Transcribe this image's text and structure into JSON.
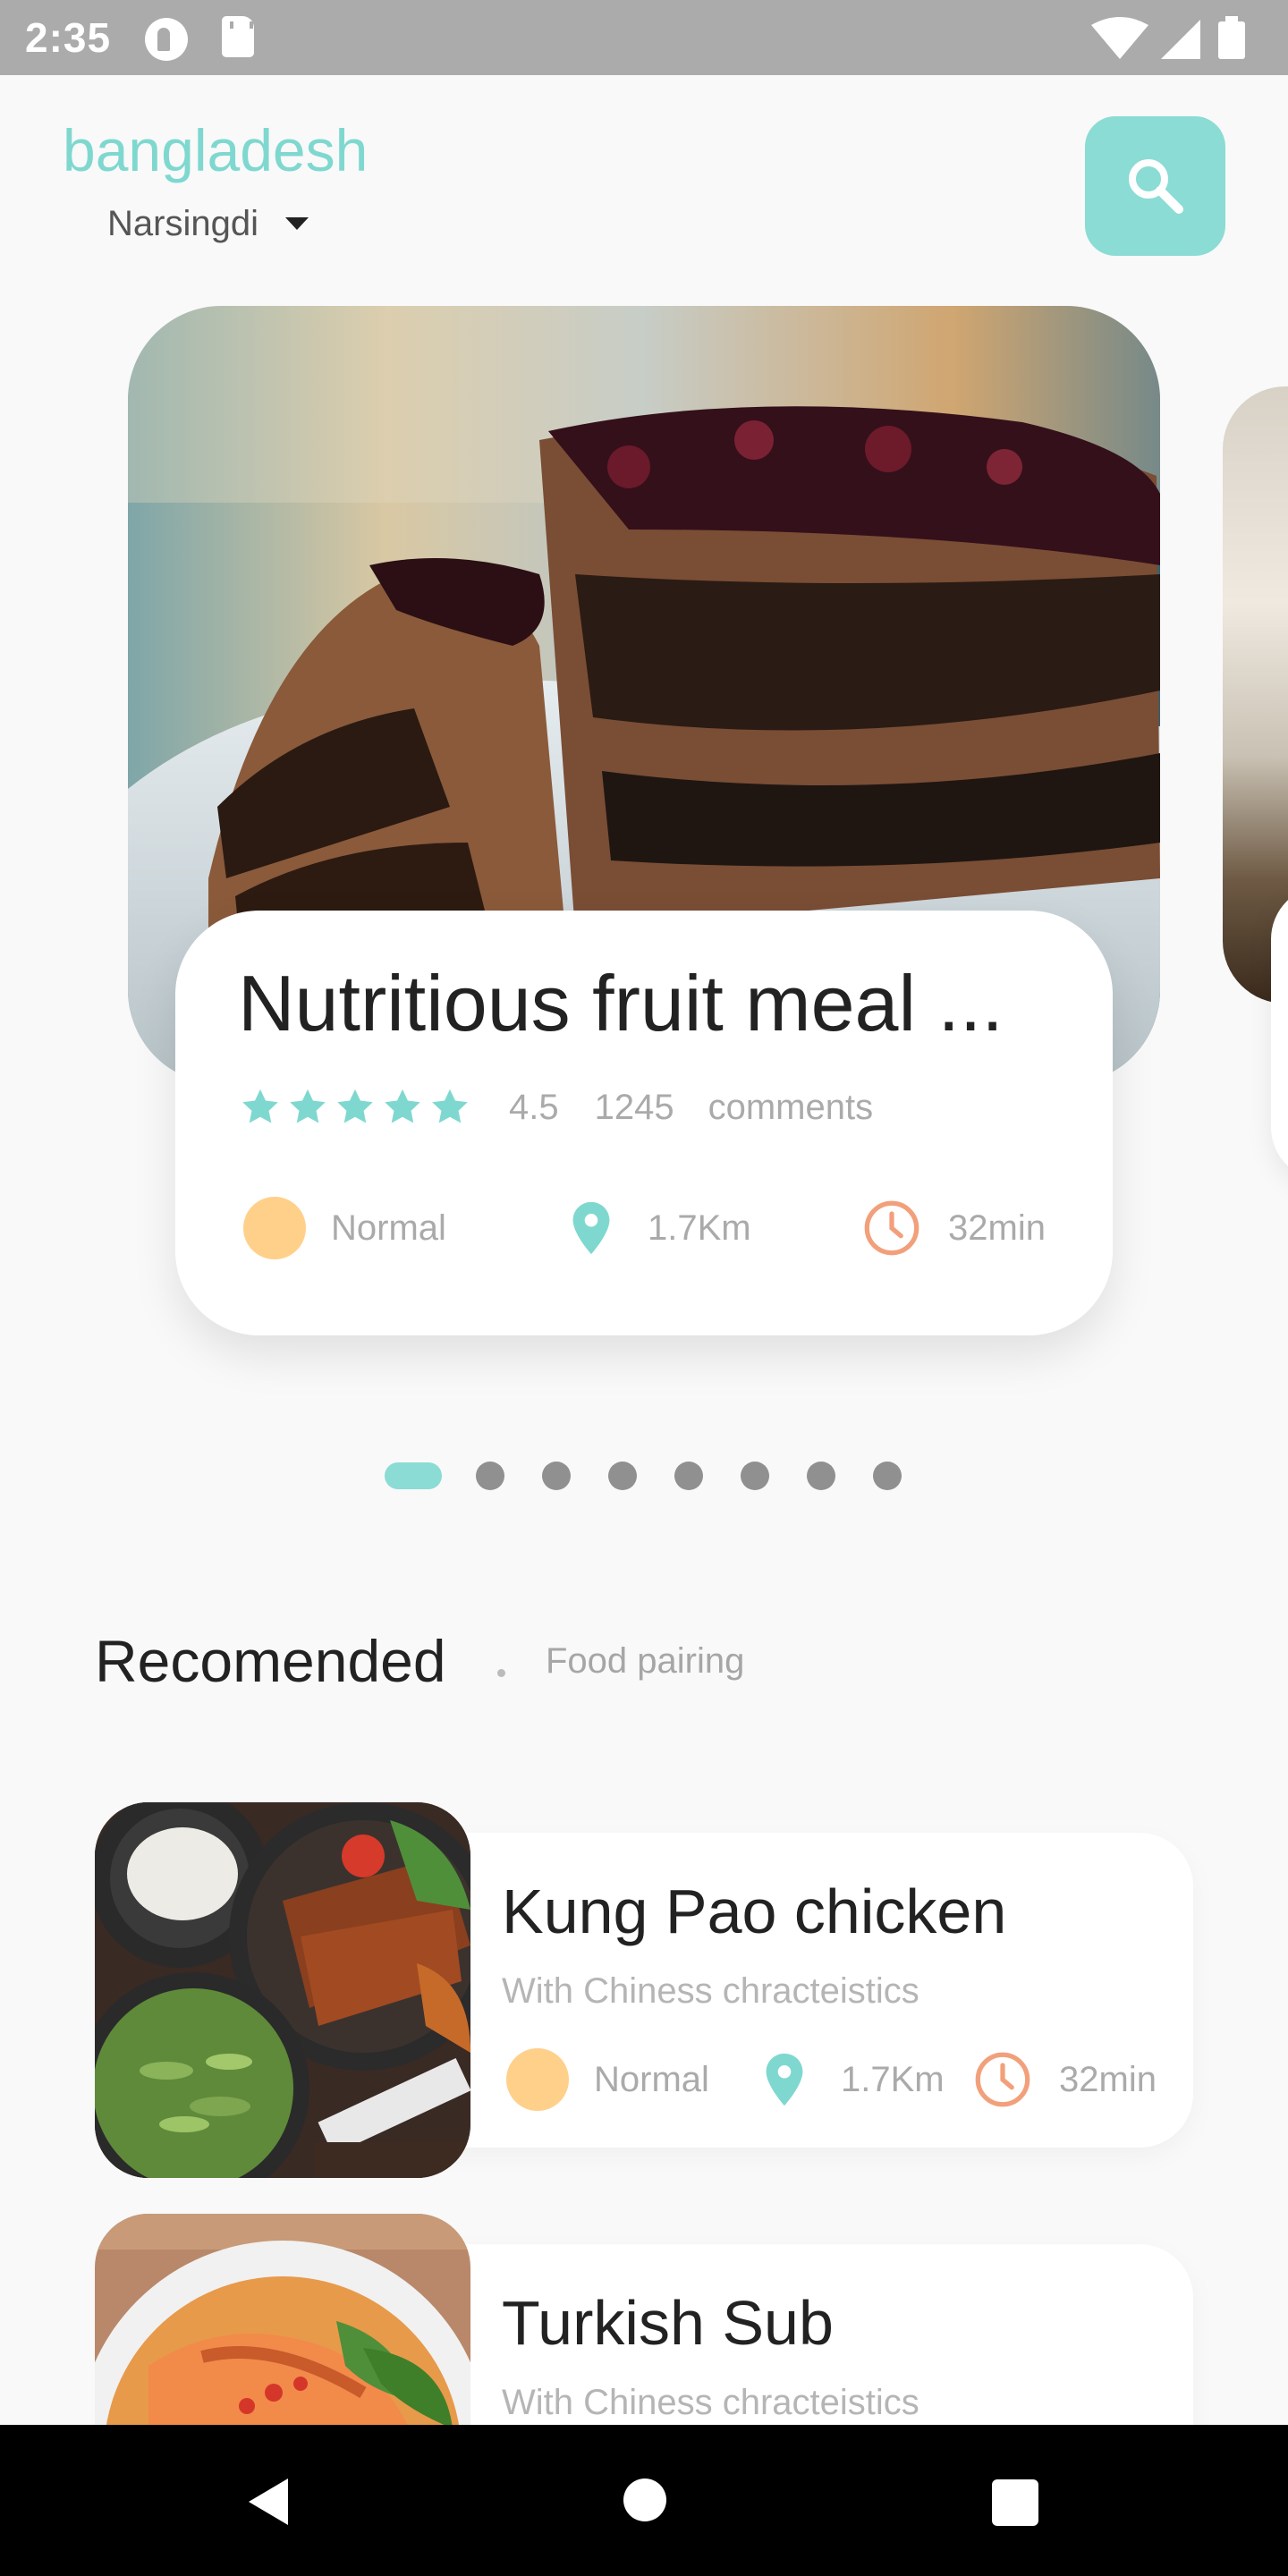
{
  "status_bar": {
    "time": "2:35",
    "icons": [
      "app-notification-icon",
      "sd-card-icon",
      "wifi-icon",
      "cell-signal-icon",
      "battery-icon"
    ]
  },
  "header": {
    "country": "bangladesh",
    "city": "Narsingdi",
    "search_icon": "search-icon"
  },
  "hero": {
    "title": "Nutritious fruit meal ...",
    "rating": "4.5",
    "stars": 5,
    "comments_count": "1245",
    "comments_label": "comments",
    "level": "Normal",
    "distance": "1.7Km",
    "time": "32min"
  },
  "pager": {
    "total": 8,
    "active_index": 0
  },
  "recommended": {
    "title": "Recomended",
    "subtitle": "Food pairing",
    "items": [
      {
        "name": "Kung Pao chicken",
        "description": "With Chiness chracteistics",
        "level": "Normal",
        "distance": "1.7Km",
        "time": "32min"
      },
      {
        "name": "Turkish Sub",
        "description": "With Chiness chracteistics"
      }
    ]
  },
  "colors": {
    "accent": "#8adcd4",
    "accent_text": "#7fd8cf",
    "level_dot": "#ffd08a",
    "clock": "#f2a07b"
  }
}
